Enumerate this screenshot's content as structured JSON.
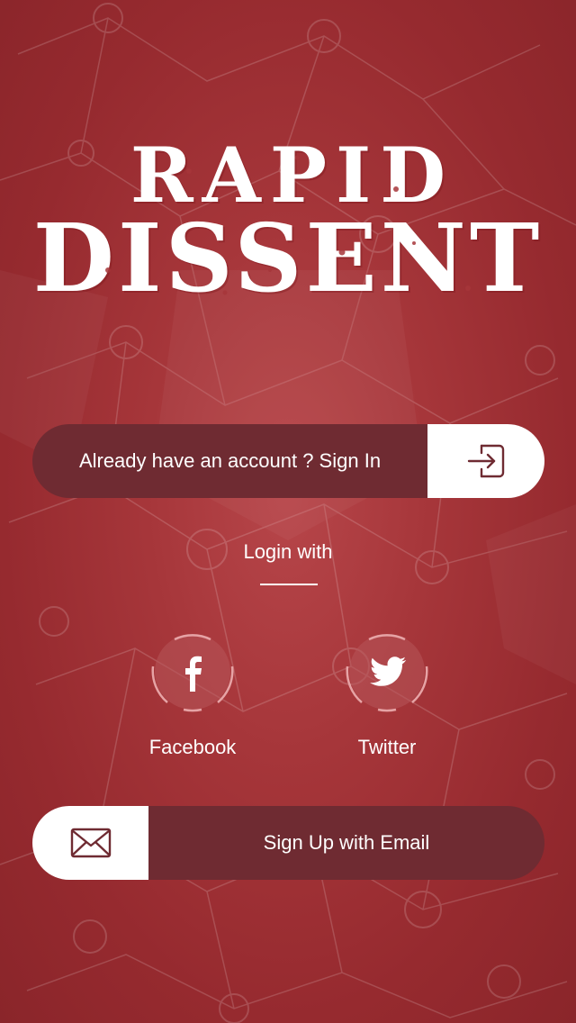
{
  "app": {
    "logo_line1": "RAPID",
    "logo_line2": "DISSENT"
  },
  "signin": {
    "label": "Already have an account ? Sign In",
    "icon": "sign-in-icon"
  },
  "login_with": {
    "label": "Login with"
  },
  "social": [
    {
      "label": "Facebook",
      "icon": "facebook-icon"
    },
    {
      "label": "Twitter",
      "icon": "twitter-icon"
    }
  ],
  "signup": {
    "label": "Sign Up with Email",
    "icon": "envelope-icon"
  },
  "colors": {
    "background": "#a6363a",
    "button_dark": "#6f2b32",
    "button_light": "#ffffff",
    "icon_stroke": "#6f2b32",
    "text": "#ffffff"
  }
}
